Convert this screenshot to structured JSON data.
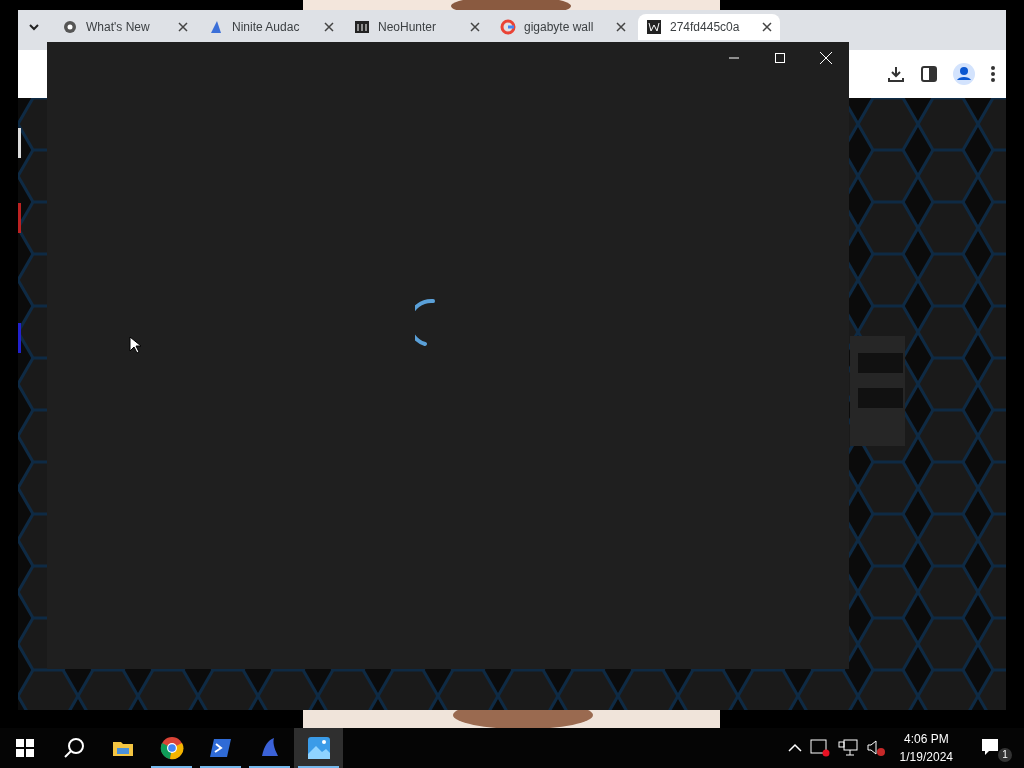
{
  "browser": {
    "tabs": [
      {
        "label": "What's New",
        "selected": false
      },
      {
        "label": "Ninite Audac",
        "selected": false
      },
      {
        "label": "NeoHunter",
        "selected": false
      },
      {
        "label": "gigabyte wall",
        "selected": false
      },
      {
        "label": "274fd445c0a",
        "selected": true
      }
    ]
  },
  "taskbar": {
    "apps": [
      {
        "active": false
      },
      {
        "active": true
      },
      {
        "active": true
      },
      {
        "active": true
      },
      {
        "active": true,
        "selected": true
      }
    ],
    "time": "4:06 PM",
    "date": "1/19/2024",
    "notifications": "1"
  }
}
